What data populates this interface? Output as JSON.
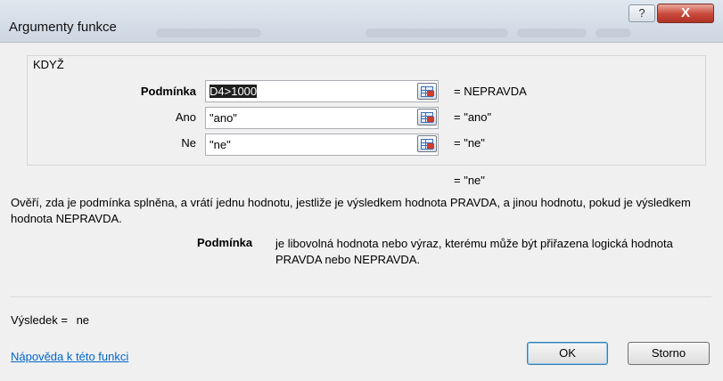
{
  "window": {
    "title": "Argumenty funkce",
    "help_glyph": "?",
    "close_glyph": "X"
  },
  "function": {
    "name": "KDYŽ"
  },
  "arguments": [
    {
      "label": "Podmínka",
      "value": "D4>1000",
      "result": "= NEPRAVDA"
    },
    {
      "label": "Ano",
      "value": "\"ano\"",
      "result": "= \"ano\""
    },
    {
      "label": "Ne",
      "value": "\"ne\"",
      "result": "= \"ne\""
    }
  ],
  "formula_result": "= \"ne\"",
  "description": "Ověří, zda je podmínka splněna, a vrátí jednu hodnotu, jestliže je výsledkem hodnota PRAVDA, a jinou hodnotu, pokud je výsledkem hodnota NEPRAVDA.",
  "parameter_help": {
    "name": "Podmínka",
    "text": "je libovolná hodnota nebo výraz, kterému může být přiřazena logická hodnota PRAVDA nebo NEPRAVDA."
  },
  "result": {
    "label": "Výsledek =",
    "value": "ne"
  },
  "help_link": "Nápověda k této funkci",
  "buttons": {
    "ok": "OK",
    "cancel": "Storno"
  },
  "icons": {
    "range_selector": "collapse-dialog-icon"
  }
}
